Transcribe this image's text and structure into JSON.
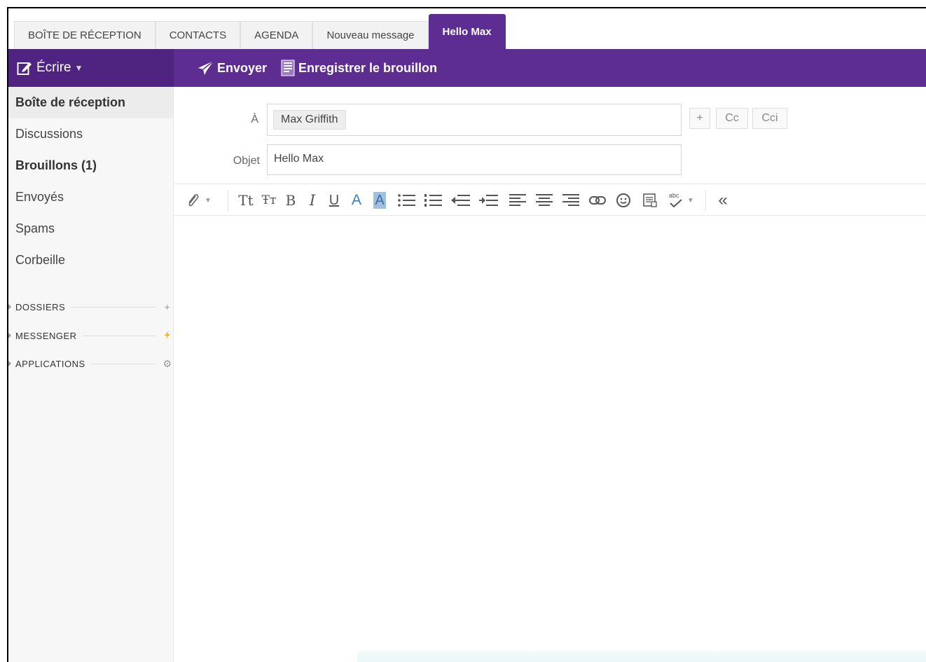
{
  "tabs": [
    {
      "label": "BOÎTE DE RÉCEPTION",
      "active": false
    },
    {
      "label": "CONTACTS",
      "active": false
    },
    {
      "label": "AGENDA",
      "active": false
    },
    {
      "label": "Nouveau message",
      "active": false
    },
    {
      "label": "Hello Max",
      "active": true
    }
  ],
  "toolbar": {
    "compose_label": "Écrire",
    "send_label": "Envoyer",
    "save_draft_label": "Enregistrer le brouillon"
  },
  "sidebar": {
    "items": [
      {
        "label": "Boîte de réception",
        "state": "selected"
      },
      {
        "label": "Discussions",
        "state": "normal"
      },
      {
        "label": "Brouillons (1)",
        "state": "bold"
      },
      {
        "label": "Envoyés",
        "state": "normal"
      },
      {
        "label": "Spams",
        "state": "normal"
      },
      {
        "label": "Corbeille",
        "state": "normal"
      }
    ],
    "sections": [
      {
        "label": "DOSSIERS",
        "icon": "plus-icon"
      },
      {
        "label": "MESSENGER",
        "icon": "lightning-icon"
      },
      {
        "label": "APPLICATIONS",
        "icon": "gear-icon"
      }
    ]
  },
  "compose": {
    "to_label": "À",
    "to_recipient": "Max Griffith",
    "add_label": "+",
    "cc_label": "Cc",
    "bcc_label": "Cci",
    "subject_label": "Objet",
    "subject_value": "Hello Max",
    "editor_tools": [
      "attach-icon",
      "font-size-icon",
      "font-family-icon",
      "bold-icon",
      "italic-icon",
      "underline-icon",
      "text-color-icon",
      "highlight-color-icon",
      "bullet-list-icon",
      "numbered-list-icon",
      "outdent-icon",
      "indent-icon",
      "align-left-icon",
      "align-center-icon",
      "align-right-icon",
      "link-icon",
      "emoji-icon",
      "insert-image-icon",
      "spellcheck-icon",
      "collapse-toolbar-icon"
    ],
    "tool_glyphs": {
      "bold": "B",
      "italic": "I",
      "underline": "U",
      "text_color": "A",
      "highlight": "A",
      "font_size": "Tt",
      "font_family": "Ŧт",
      "collapse": "«",
      "abc": "abc"
    }
  },
  "colors": {
    "brand_purple": "#5e2d91",
    "compose_purple": "#4f2480",
    "text_color_blue": "#3a7fc1"
  }
}
